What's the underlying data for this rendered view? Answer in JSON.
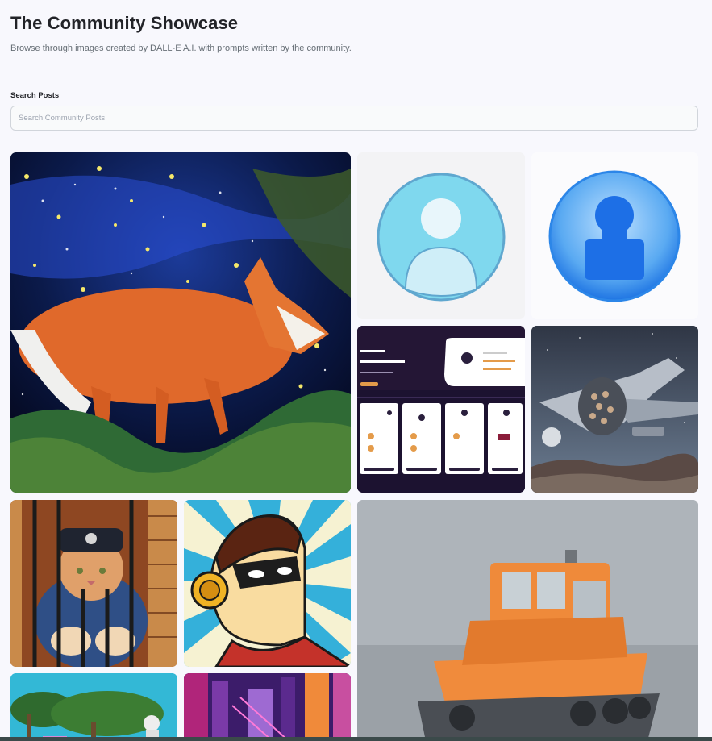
{
  "header": {
    "title": "The Community Showcase",
    "subtitle": "Browse through images created by DALL-E A.I. with prompts written by the community."
  },
  "search": {
    "label": "Search Posts",
    "placeholder": "Search Community Posts",
    "value": ""
  },
  "gallery": {
    "cards": [
      {
        "name": "fox-starry-night",
        "subject": "orange fox under starry sky painting"
      },
      {
        "name": "user-avatar-icon-cyan",
        "subject": "cyan user avatar icon"
      },
      {
        "name": "user-avatar-icon-blue",
        "subject": "blue user avatar icon"
      },
      {
        "name": "dashboard-ui-mockup",
        "subject": "dark app dashboard mockup"
      },
      {
        "name": "spaceship",
        "subject": "spaceship over rocky planet"
      },
      {
        "name": "cat-in-jail",
        "subject": "orange cat behind bars painting"
      },
      {
        "name": "superhero-headphones",
        "subject": "masked hero with headphones pop art"
      },
      {
        "name": "orange-tugboat-3d",
        "subject": "orange 3d tugboat render"
      },
      {
        "name": "palm-trees-astronaut",
        "subject": "palm trees with astronaut"
      },
      {
        "name": "neon-city",
        "subject": "neon cyberpunk city street"
      }
    ]
  },
  "colors": {
    "background": "#f8f8fd",
    "title": "#222328",
    "subtitle": "#666e75"
  }
}
